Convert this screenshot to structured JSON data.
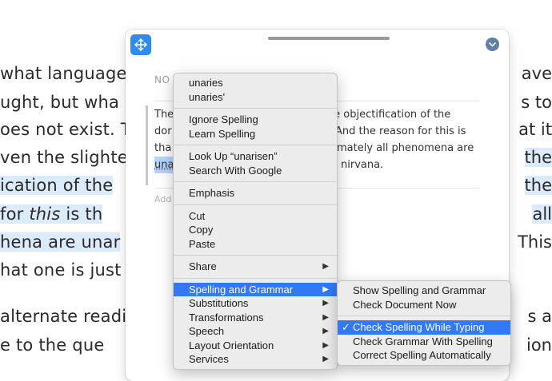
{
  "background_doc": {
    "lines_left": [
      {
        "text": "what language",
        "highlight": false
      },
      {
        "text": "ught, but wha",
        "highlight": false
      },
      {
        "text": "oes not exist. T",
        "highlight": false
      },
      {
        "text": "ven the slighte",
        "highlight": false
      },
      {
        "text": "ication of the",
        "highlight": true
      },
      {
        "text_pre": " for ",
        "text_italic": "this",
        "text_post": " is th",
        "highlight": true
      },
      {
        "text": "hena are unar",
        "highlight": true
      },
      {
        "text": "hat one is just",
        "highlight": false
      },
      {
        "text": "alternate readi",
        "highlight": false
      },
      {
        "text": "e to the que",
        "highlight": false
      }
    ],
    "lines_right": [
      {
        "text": "ave",
        "highlight": false
      },
      {
        "text": "s to",
        "highlight": false
      },
      {
        "text": "at it",
        "highlight": false
      },
      {
        "text": "the",
        "highlight": true
      },
      {
        "text": "the",
        "highlight": true
      },
      {
        "text": "all",
        "highlight": true
      },
      {
        "text": "This",
        "highlight": false
      },
      {
        "text": "s a",
        "highlight": false
      },
      {
        "text": "ion",
        "highlight": false
      }
    ]
  },
  "note_panel": {
    "label": "NO",
    "text_lines": [
      {
        "left": "The",
        "right": "y the objectification of the"
      },
      {
        "left": "dor",
        "right": "And the reason for this is"
      },
      {
        "left": "tha",
        "right": "mately all phenomena are"
      },
      {
        "left_selected": "una",
        "right": "nirvana."
      }
    ],
    "add_label": "Add",
    "icons": {
      "move": "move-arrows-icon",
      "collapse": "chevron-down-icon"
    }
  },
  "context_menu": {
    "groups": [
      [
        {
          "label": "unaries"
        },
        {
          "label": "unaries'"
        }
      ],
      [
        {
          "label": "Ignore Spelling"
        },
        {
          "label": "Learn Spelling"
        }
      ],
      [
        {
          "label": "Look Up “unarisen”"
        },
        {
          "label": "Search With Google"
        }
      ],
      [
        {
          "label": "Emphasis"
        }
      ],
      [
        {
          "label": "Cut"
        },
        {
          "label": "Copy"
        },
        {
          "label": "Paste"
        }
      ],
      [
        {
          "label": "Share",
          "submenu": true
        }
      ],
      [
        {
          "label": "Spelling and Grammar",
          "submenu": true,
          "active": true
        },
        {
          "label": "Substitutions",
          "submenu": true
        },
        {
          "label": "Transformations",
          "submenu": true
        },
        {
          "label": "Speech",
          "submenu": true
        },
        {
          "label": "Layout Orientation",
          "submenu": true
        },
        {
          "label": "Services",
          "submenu": true
        }
      ]
    ]
  },
  "submenu": {
    "groups": [
      [
        {
          "label": "Show Spelling and Grammar"
        },
        {
          "label": "Check Document Now"
        }
      ],
      [
        {
          "label": "Check Spelling While Typing",
          "checked": true,
          "active": true
        },
        {
          "label": "Check Grammar With Spelling"
        },
        {
          "label": "Correct Spelling Automatically"
        }
      ]
    ]
  },
  "colors": {
    "accent": "#3478f6",
    "selection": "#dcebfb",
    "move_button": "#2e8ef0"
  }
}
